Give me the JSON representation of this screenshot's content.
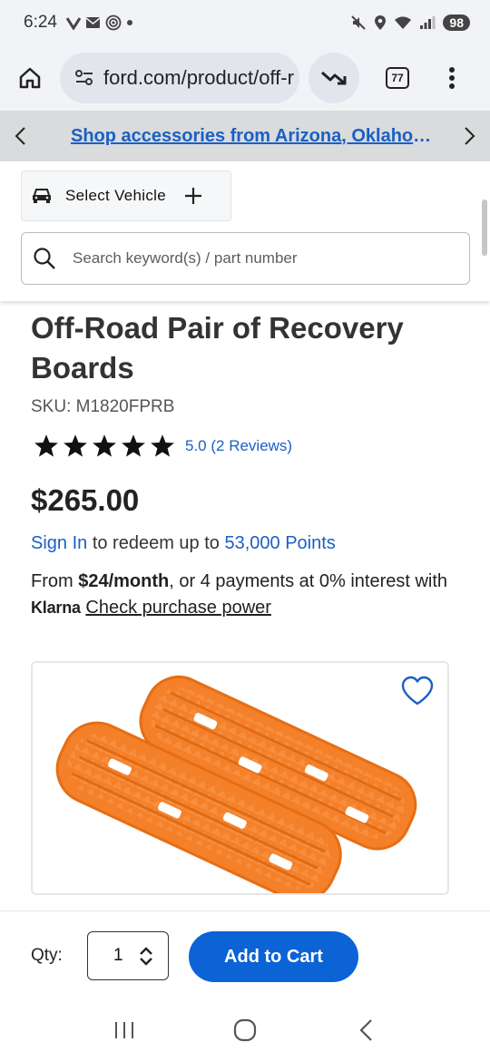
{
  "status_bar": {
    "time": "6:24",
    "battery": "98"
  },
  "browser": {
    "url": "ford.com/product/off-road-pair-of-recovery-boards",
    "tab_count": "77"
  },
  "promo": {
    "text": "Shop accessories from Arizona, Oklahoma and more"
  },
  "header": {
    "select_vehicle": "Select Vehicle",
    "search_placeholder": "Search keyword(s) / part number"
  },
  "product": {
    "title": "Off-Road Pair of Recovery Boards",
    "sku": "SKU: M1820FPRB",
    "rating_value": 5.0,
    "rating_text": "5.0 (2 Reviews)",
    "price": "$265.00",
    "points_link": "Sign In",
    "points_middle": " to redeem up to ",
    "points_amount": "53,000 Points",
    "financing_prefix": "From ",
    "financing_amount": "$24/month",
    "financing_suffix": ", or 4 payments at 0% interest with ",
    "klarna_logo": "Klarna",
    "klarna_link": "Check purchase power"
  },
  "cart": {
    "qty_label": "Qty:",
    "qty_value": "1",
    "add_to_cart": "Add to Cart"
  },
  "colors": {
    "accent_blue": "#0b63d6",
    "link_blue": "#1b5fc4",
    "product_orange": "#f5802a"
  }
}
